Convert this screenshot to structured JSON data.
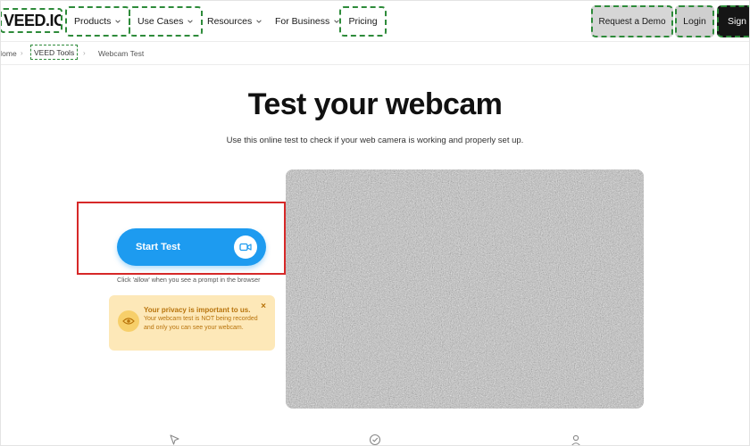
{
  "header": {
    "logo": "VEED.IO",
    "nav": [
      {
        "label": "Products",
        "has_dropdown": true,
        "highlighted": true
      },
      {
        "label": "Use Cases",
        "has_dropdown": true,
        "highlighted": true
      },
      {
        "label": "Resources",
        "has_dropdown": true,
        "highlighted": false
      },
      {
        "label": "For Business",
        "has_dropdown": true,
        "highlighted": false
      },
      {
        "label": "Pricing",
        "has_dropdown": false,
        "highlighted": true
      }
    ],
    "request_demo_label": "Request a Demo",
    "login_label": "Login",
    "signup_label": "Sign Up"
  },
  "breadcrumb": {
    "home": "Home",
    "tools": "VEED Tools",
    "current": "Webcam Test"
  },
  "hero": {
    "title": "Test your webcam",
    "subtitle": "Use this online test to check if your web camera is working and properly set up."
  },
  "start_test": {
    "label": "Start Test",
    "hint": "Click 'allow' when you see a prompt in the browser"
  },
  "privacy": {
    "title": "Your privacy is important to us.",
    "text": "Your webcam test is NOT being recorded and only you can see your webcam.",
    "close": "×"
  },
  "colors": {
    "accent_blue": "#1d9bf0",
    "highlight_green": "#2e8b3a",
    "highlight_red": "#d62828",
    "privacy_bg": "#fde8b8",
    "privacy_text": "#b8730b"
  },
  "icons": [
    "chevron-down-icon",
    "video-camera-icon",
    "eye-icon",
    "close-icon",
    "cursor-icon",
    "check-circle-icon",
    "user-icon"
  ]
}
